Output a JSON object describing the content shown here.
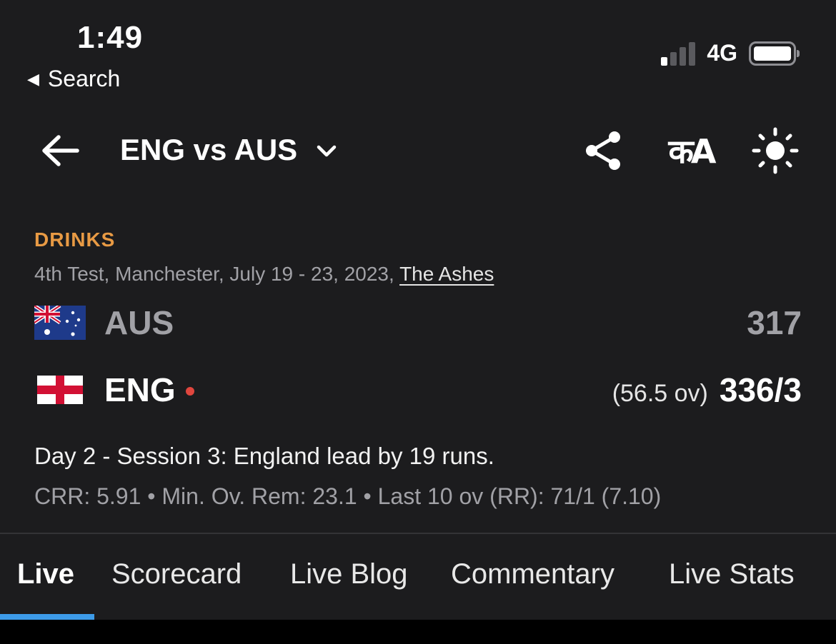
{
  "status_bar": {
    "time": "1:49",
    "back_app": "Search",
    "network": "4G",
    "signal_bars_active": 1,
    "signal_bars_total": 4,
    "battery_level": 1.0
  },
  "header": {
    "title": "ENG vs AUS",
    "icons": [
      "back-arrow-icon",
      "chevron-down-icon",
      "share-icon",
      "language-icon",
      "brightness-icon"
    ],
    "language_label": "कA"
  },
  "match": {
    "status": "DRINKS",
    "info": "4th Test, Manchester, July 19 - 23, 2023, ",
    "series": "The Ashes",
    "teams": [
      {
        "name": "AUS",
        "overs": "",
        "score": "317",
        "batting": false,
        "color": "#a1a1a6"
      },
      {
        "name": "ENG",
        "overs": "(56.5 ov)",
        "score": "336/3",
        "batting": true,
        "color": "#ffffff"
      }
    ],
    "summary": "Day 2 - Session 3: England lead by 19 runs.",
    "stats": "CRR: 5.91 • Min. Ov. Rem: 23.1 • Last 10 ov (RR): 71/1 (7.10)"
  },
  "tabs": [
    {
      "label": "Live",
      "active": true
    },
    {
      "label": "Scorecard",
      "active": false
    },
    {
      "label": "Live Blog",
      "active": false
    },
    {
      "label": "Commentary",
      "active": false
    },
    {
      "label": "Live Stats",
      "active": false
    }
  ],
  "colors": {
    "background": "#1c1c1e",
    "status_accent": "#e89a44",
    "live_dot": "#e0463e",
    "tab_indicator": "#3d9be9"
  }
}
